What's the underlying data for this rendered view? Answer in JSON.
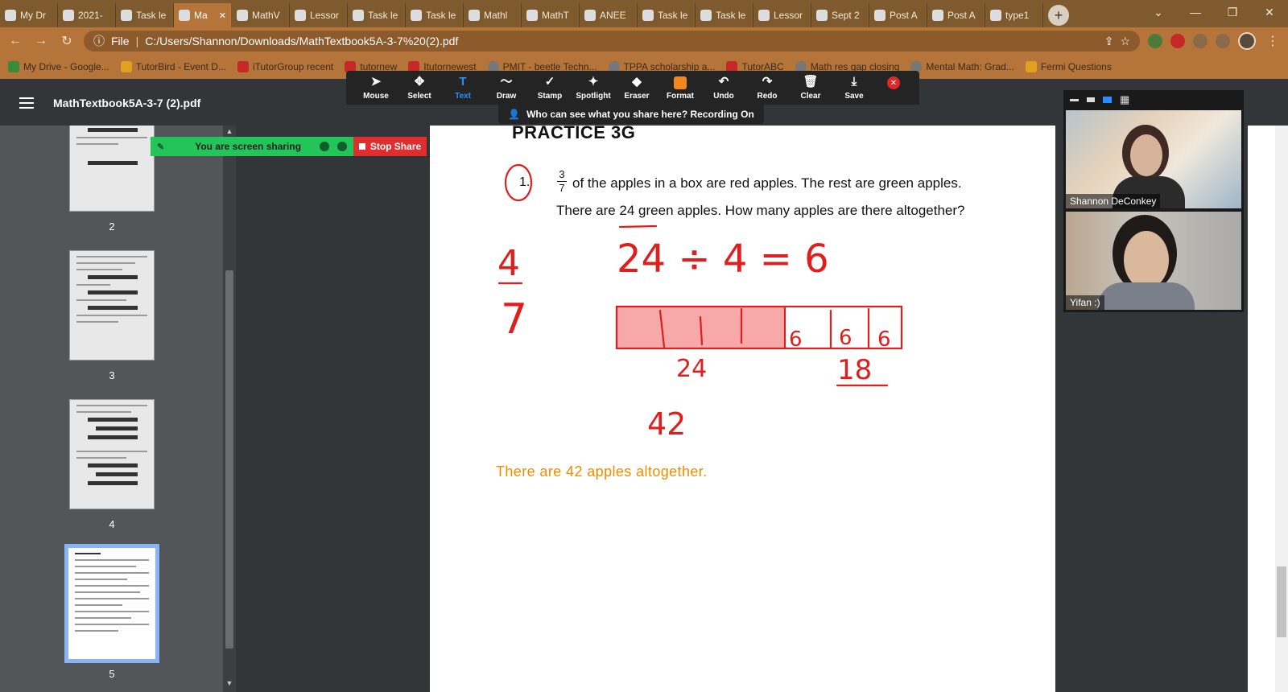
{
  "browser": {
    "tabs": [
      {
        "label": "My Dr",
        "icon": "google-drive-icon"
      },
      {
        "label": "2021-",
        "icon": "google-sheets-icon"
      },
      {
        "label": "Task le",
        "icon": "doc-icon"
      },
      {
        "label": "Ma",
        "icon": "globe-icon",
        "active": true
      },
      {
        "label": "MathV",
        "icon": "globe-icon"
      },
      {
        "label": "Lessor",
        "icon": "doc-icon"
      },
      {
        "label": "Task le",
        "icon": "doc-icon"
      },
      {
        "label": "Task le",
        "icon": "doc-icon"
      },
      {
        "label": "Mathl",
        "icon": "globe-icon"
      },
      {
        "label": "MathT",
        "icon": "globe-icon"
      },
      {
        "label": "ANEE",
        "icon": "doc-icon"
      },
      {
        "label": "Task le",
        "icon": "doc-icon"
      },
      {
        "label": "Task le",
        "icon": "doc-icon"
      },
      {
        "label": "Lessor",
        "icon": "doc-icon"
      },
      {
        "label": "Sept 2",
        "icon": "google-docs-icon"
      },
      {
        "label": "Post A",
        "icon": "zoom-icon"
      },
      {
        "label": "Post A",
        "icon": "zoom-icon"
      },
      {
        "label": "type1",
        "icon": "mw-icon"
      }
    ],
    "new_tab": "+",
    "url_scheme": "File",
    "url": "C:/Users/Shannon/Downloads/MathTextbook5A-3-7%20(2).pdf",
    "bookmarks": [
      {
        "label": "My Drive - Google...",
        "color": "g"
      },
      {
        "label": "TutorBird - Event D...",
        "color": "y"
      },
      {
        "label": "iTutorGroup recent",
        "color": "r"
      },
      {
        "label": "tutornew",
        "color": "r"
      },
      {
        "label": "Itutornewest",
        "color": "r"
      },
      {
        "label": "PMIT - beetle Techn...",
        "color": "grey"
      },
      {
        "label": "TPPA scholarship a...",
        "color": "grey"
      },
      {
        "label": "TutorABC",
        "color": "r"
      },
      {
        "label": "Math res gap closing",
        "color": "grey"
      },
      {
        "label": "Mental Math: Grad...",
        "color": "grey"
      },
      {
        "label": "Fermi Questions",
        "color": "y"
      }
    ]
  },
  "pdf": {
    "title": "MathTextbook5A-3-7 (2).pdf",
    "thumbnails": [
      "2",
      "3",
      "4",
      "5"
    ],
    "page": {
      "heading": "PRACTICE 3G",
      "question_number": "1.",
      "fraction_num": "3",
      "fraction_den": "7",
      "line1": "of the apples in a box are red apples. The rest are green apples.",
      "line2": "There are 24 green apples. How many apples are there altogether?",
      "typed_answer": "There are 42 apples altogether.",
      "handwriting": {
        "fraction_num": "4",
        "fraction_den": "7",
        "equation": "24 ÷ 4 = 6",
        "unit_labels": [
          "6",
          "6",
          "6"
        ],
        "label_left": "24",
        "label_right": "18",
        "total": "42"
      }
    }
  },
  "zoom": {
    "tools": [
      {
        "label": "Mouse",
        "icon": "mouse-pointer-icon"
      },
      {
        "label": "Select",
        "icon": "move-icon"
      },
      {
        "label": "Text",
        "icon": "text-icon",
        "active": true
      },
      {
        "label": "Draw",
        "icon": "draw-icon"
      },
      {
        "label": "Stamp",
        "icon": "checkmark-icon"
      },
      {
        "label": "Spotlight",
        "icon": "spotlight-icon"
      },
      {
        "label": "Eraser",
        "icon": "eraser-icon"
      },
      {
        "label": "Format",
        "icon": "format-icon"
      },
      {
        "label": "Undo",
        "icon": "undo-icon"
      },
      {
        "label": "Redo",
        "icon": "redo-icon"
      },
      {
        "label": "Clear",
        "icon": "trash-icon"
      },
      {
        "label": "Save",
        "icon": "save-icon"
      }
    ],
    "recording_notice": "Who can see what you share here? Recording On",
    "sharing_label": "You are screen sharing",
    "stop_share": "Stop Share",
    "participants": [
      "Shannon DeConkey",
      "Yifan :)"
    ]
  },
  "colors": {
    "ink_red": "#e01e1e",
    "answer_orange": "#f08c00",
    "share_green": "#23c45a",
    "stop_red": "#e02d2d",
    "zoom_blue": "#2d8cff"
  }
}
